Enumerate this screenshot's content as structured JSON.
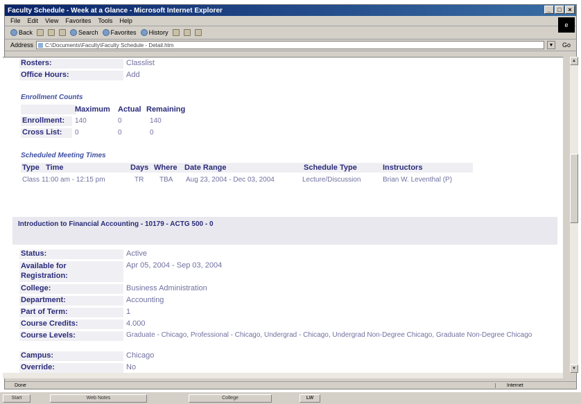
{
  "window": {
    "title": "Faculty Schedule - Week at a Glance - Microsoft Internet Explorer",
    "menu": [
      "File",
      "Edit",
      "View",
      "Favorites",
      "Tools",
      "Help"
    ],
    "toolbar": [
      "Back",
      "Search",
      "Favorites",
      "History"
    ],
    "address_label": "Address",
    "address_value": "C:\\Documents\\Faculty\\Faculty Schedule - Detail.htm",
    "go_label": "Go",
    "status_text": "Done",
    "zone_text": "Internet"
  },
  "top_rows": [
    {
      "label": "Rosters:",
      "value": "Classlist"
    },
    {
      "label": "Office Hours:",
      "value": "Add"
    }
  ],
  "enrollment": {
    "title": "Enrollment Counts",
    "headers": [
      "Maximum",
      "Actual",
      "Remaining"
    ],
    "rows": [
      {
        "label": "Enrollment:",
        "values": [
          "140",
          "0",
          "140"
        ]
      },
      {
        "label": "Cross List:",
        "values": [
          "0",
          "0",
          "0"
        ]
      }
    ]
  },
  "meetings": {
    "title": "Scheduled Meeting Times",
    "headers": [
      "Type",
      "Time",
      "Days",
      "Where",
      "Date Range",
      "Schedule Type",
      "Instructors"
    ],
    "row": [
      "Class",
      "11:00 am - 12:15 pm",
      "TR",
      "TBA",
      "Aug 23, 2004 - Dec 03, 2004",
      "Lecture/Discussion",
      "Brian W. Leventhal (P)"
    ]
  },
  "course": {
    "title": "Introduction to Financial Accounting - 10179 - ACTG 500 - 0",
    "rows": [
      {
        "label": "Status:",
        "value": "Active"
      },
      {
        "label": "Available for Registration:",
        "value": "Apr 05, 2004 - Sep 03, 2004"
      },
      {
        "label": "College:",
        "value": "Business Administration"
      },
      {
        "label": "Department:",
        "value": "Accounting"
      },
      {
        "label": "Part of Term:",
        "value": "1"
      },
      {
        "label": "Course Credits:",
        "value": "4.000"
      },
      {
        "label": "Course Levels:",
        "value": "Graduate - Chicago, Professional - Chicago, Undergrad - Chicago, Undergrad Non-Degree Chicago, Graduate Non-Degree Chicago"
      },
      {
        "label": "Campus:",
        "value": "Chicago"
      },
      {
        "label": "Override:",
        "value": "No"
      }
    ]
  },
  "taskbar": [
    "Start",
    "Web Notes",
    "College",
    "LW"
  ]
}
